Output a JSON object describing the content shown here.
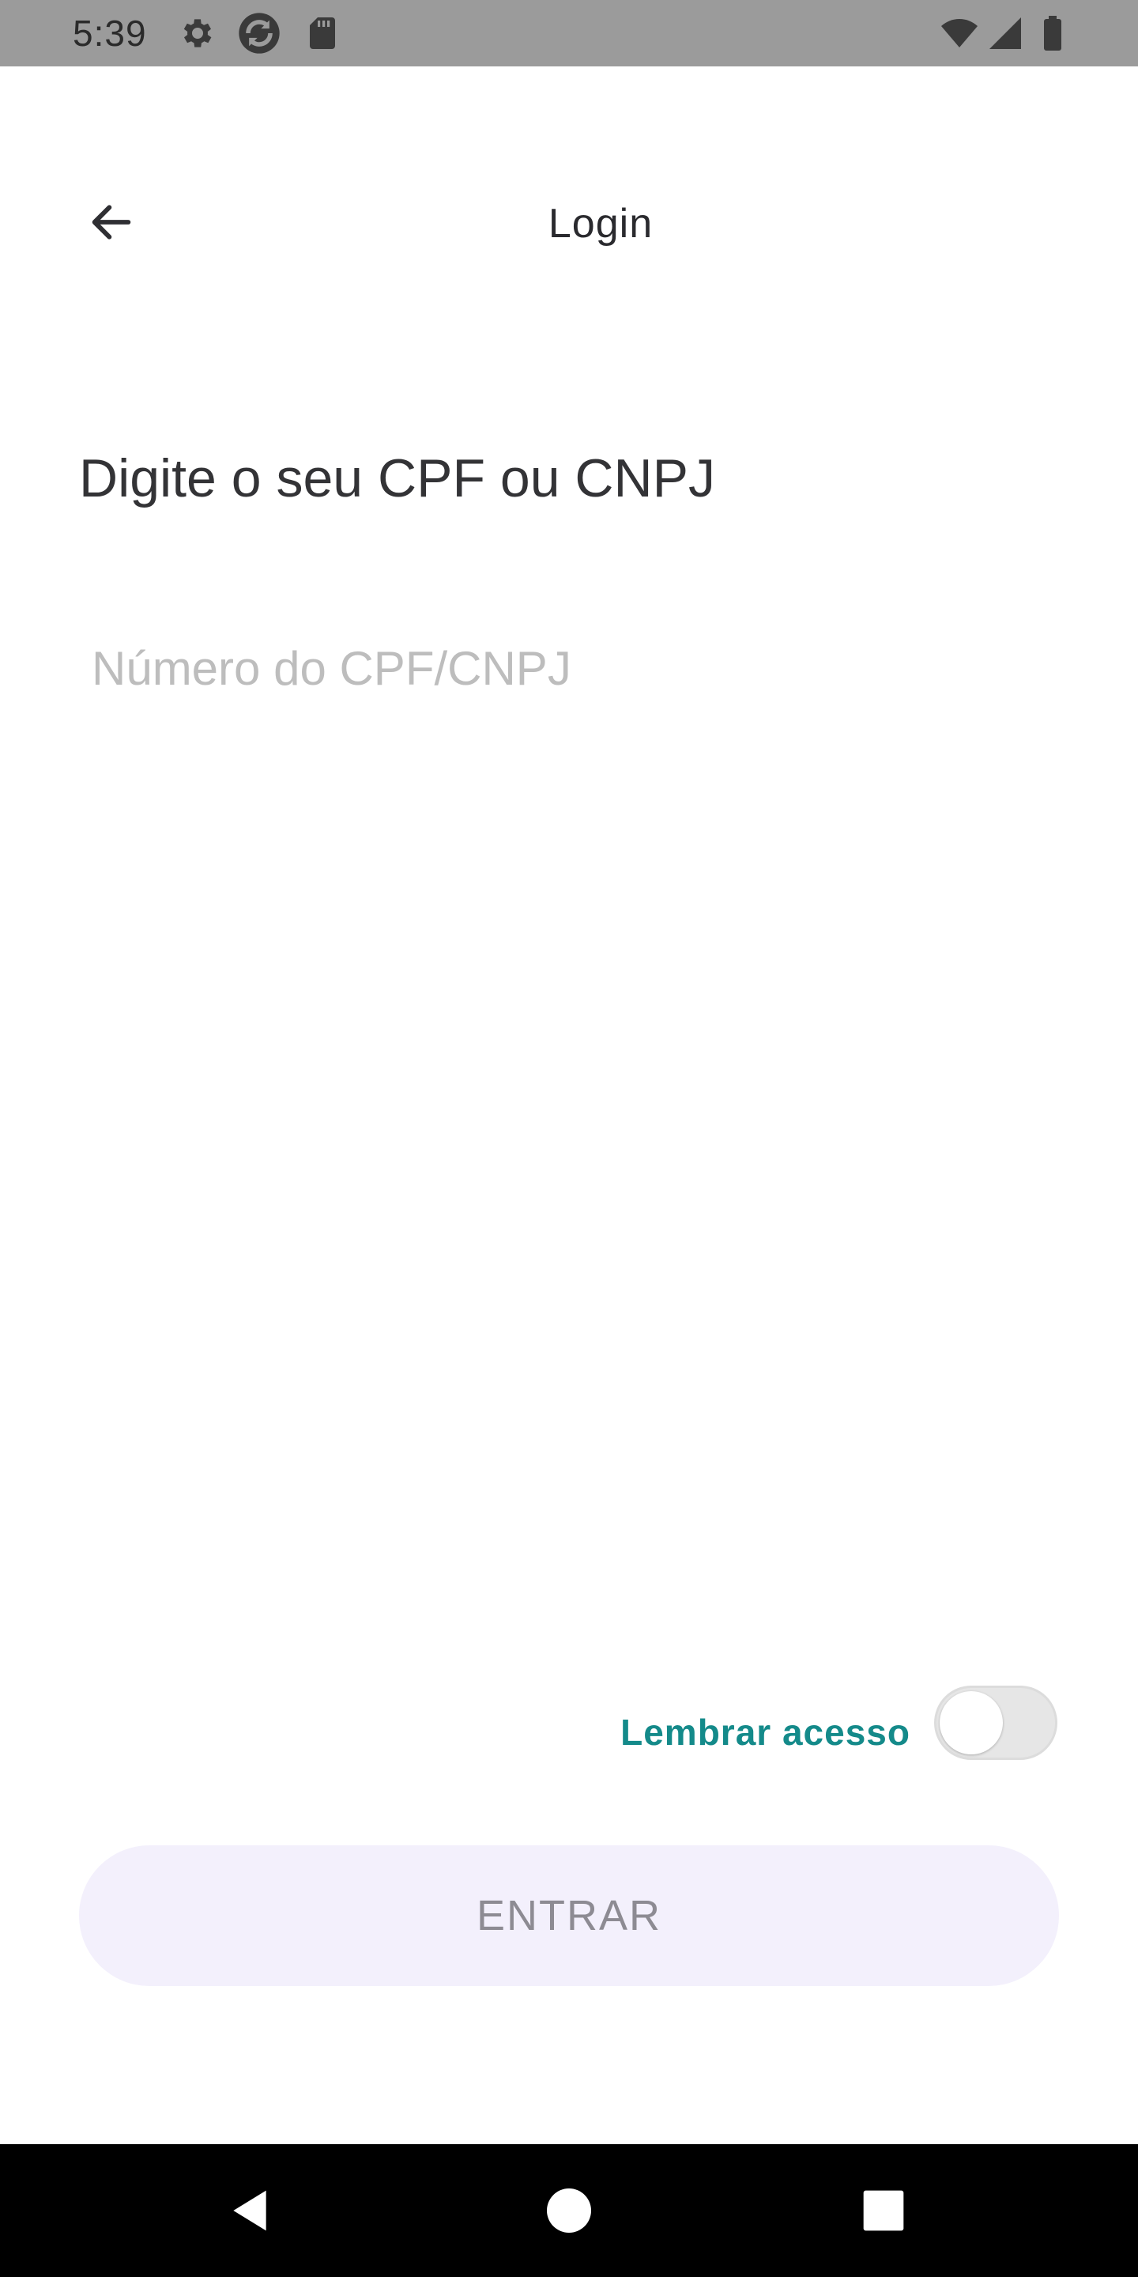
{
  "status_bar": {
    "time": "5:39",
    "icons": [
      "settings-gear-icon",
      "sync-icon",
      "sd-card-icon",
      "wifi-icon",
      "signal-icon",
      "battery-icon"
    ]
  },
  "app_bar": {
    "title": "Login",
    "back_icon": "arrow-back-icon"
  },
  "form": {
    "heading": "Digite o seu CPF ou CNPJ",
    "cpf_placeholder": "Número do CPF/CNPJ",
    "cpf_value": "",
    "remember_label": "Lembrar acesso",
    "remember_enabled": false,
    "submit_label": "ENTRAR"
  },
  "navigation_bar": {
    "buttons": [
      "back-triangle-icon",
      "home-circle-icon",
      "recents-square-icon"
    ]
  },
  "colors": {
    "status_bar_bg": "#9b9b9b",
    "accent_teal": "#148a8a",
    "button_bg": "#f3f0fc",
    "button_text": "#8d8b93",
    "placeholder": "#bdbdbd",
    "nav_bar_bg": "#000000"
  }
}
